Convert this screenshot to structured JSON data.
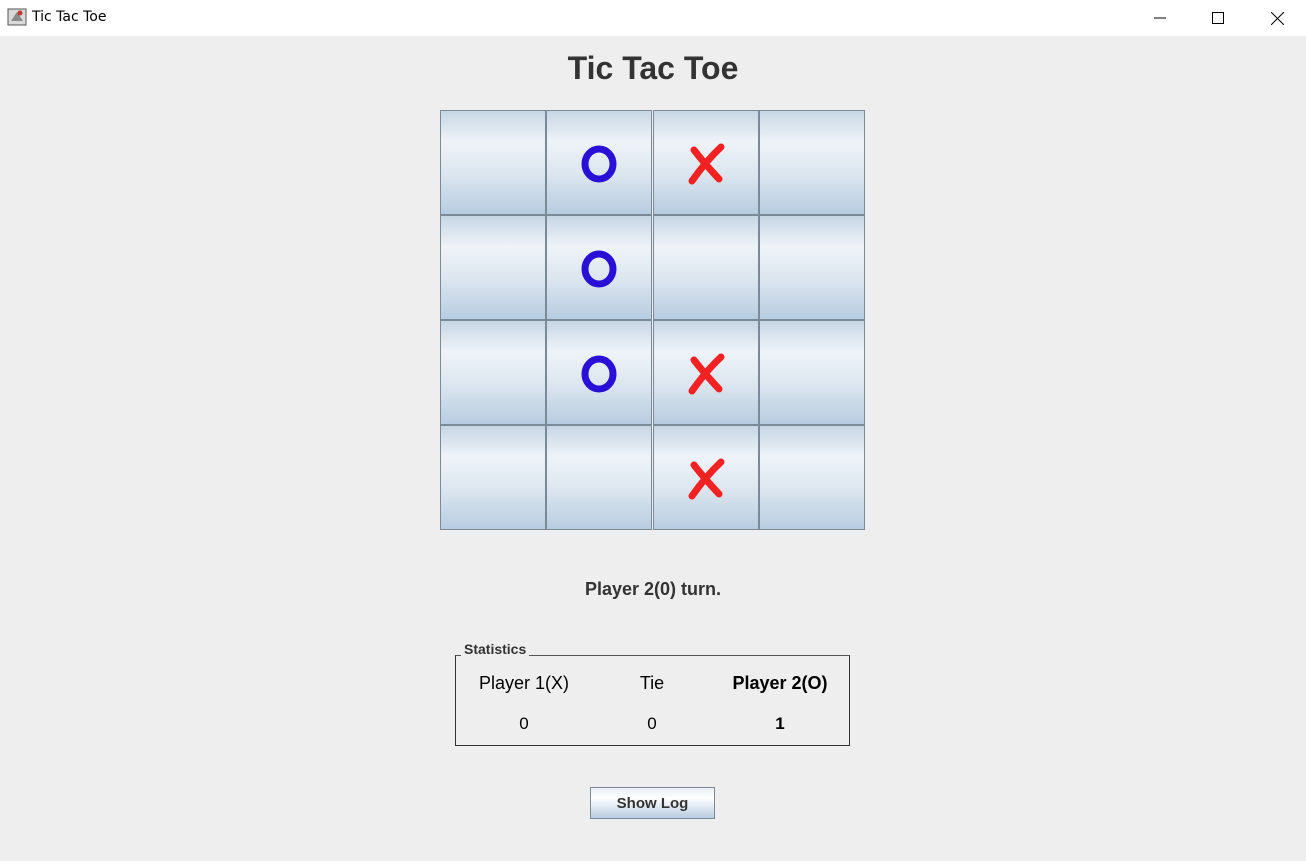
{
  "window": {
    "title": "Tic Tac Toe"
  },
  "heading": "Tic Tac Toe",
  "board": [
    [
      "",
      "O",
      "X",
      ""
    ],
    [
      "",
      "O",
      "",
      ""
    ],
    [
      "",
      "O",
      "X",
      ""
    ],
    [
      "",
      "",
      "X",
      ""
    ]
  ],
  "colors": {
    "o": "#2a0fd6",
    "x": "#f22222"
  },
  "status": "Player 2(0) turn.",
  "statistics": {
    "legend": "Statistics",
    "headers": [
      "Player 1(X)",
      "Tie",
      "Player 2(O)"
    ],
    "values": [
      "0",
      "0",
      "1"
    ]
  },
  "buttons": {
    "show_log": "Show Log"
  }
}
